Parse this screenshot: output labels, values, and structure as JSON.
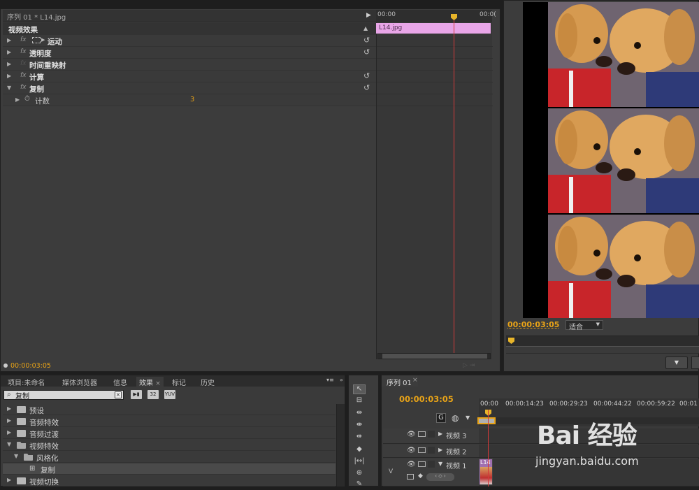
{
  "effect_controls": {
    "header": "序列 01 * L14.jpg",
    "section": "视频效果",
    "rows": [
      {
        "label": "运动",
        "has_fx": true,
        "has_reset": true
      },
      {
        "label": "透明度",
        "has_fx": true,
        "has_reset": true
      },
      {
        "label": "时间重映射",
        "has_fx": false,
        "has_reset": false
      },
      {
        "label": "计算",
        "has_fx": true,
        "has_reset": true
      },
      {
        "label": "复制",
        "has_fx": true,
        "has_reset": true
      }
    ],
    "param": {
      "label": "计数",
      "value": "3"
    },
    "ruler": {
      "start": "00:00",
      "end": "00:0("
    },
    "clip_name": "L14.jpg",
    "timecode": "00:00:03:05"
  },
  "program_monitor": {
    "timecode": "00:00:03:05",
    "fit": "适合"
  },
  "effects_panel": {
    "tabs": [
      {
        "label": "项目:未命名",
        "active": false
      },
      {
        "label": "媒体浏览器",
        "active": false
      },
      {
        "label": "信息",
        "active": false
      },
      {
        "label": "效果",
        "active": true
      },
      {
        "label": "标记",
        "active": false
      },
      {
        "label": "历史",
        "active": false
      }
    ],
    "search_value": "复制",
    "filter_buttons": [
      "32",
      "YUV"
    ],
    "tree": [
      {
        "label": "预设",
        "indent": 0,
        "expanded": false,
        "type": "folder"
      },
      {
        "label": "音频特效",
        "indent": 0,
        "expanded": false,
        "type": "folder"
      },
      {
        "label": "音频过渡",
        "indent": 0,
        "expanded": false,
        "type": "folder"
      },
      {
        "label": "视频特效",
        "indent": 0,
        "expanded": true,
        "type": "folder"
      },
      {
        "label": "风格化",
        "indent": 1,
        "expanded": true,
        "type": "folder"
      },
      {
        "label": "复制",
        "indent": 2,
        "expanded": false,
        "type": "effect"
      },
      {
        "label": "视频切换",
        "indent": 0,
        "expanded": false,
        "type": "folder"
      }
    ]
  },
  "sequence": {
    "tab": "序列 01",
    "timecode": "00:00:03:05",
    "ruler": [
      "00:00",
      "00:00:14:23",
      "00:00:29:23",
      "00:00:44:22",
      "00:00:59:22",
      "00:01"
    ],
    "tracks": [
      {
        "label": "视频 3"
      },
      {
        "label": "视频 2"
      },
      {
        "label": "视频 1"
      }
    ],
    "track_side_label": "V",
    "clip_label": "L14"
  },
  "watermark": {
    "brand": "Bai 经验",
    "url": "jingyan.baidu.com"
  }
}
